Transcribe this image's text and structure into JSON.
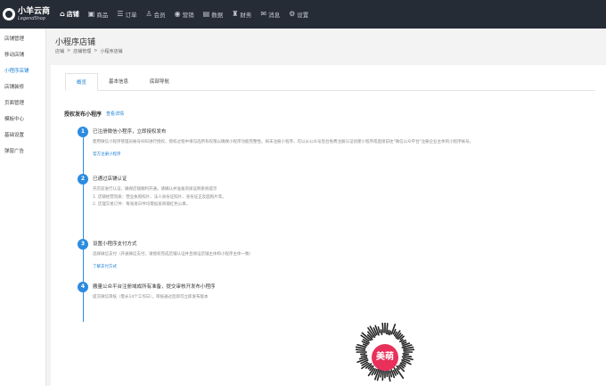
{
  "brand": {
    "name_cn": "小羊云商",
    "name_en": "LegendShop"
  },
  "nav": [
    {
      "label": "店铺",
      "icon": "home-icon",
      "glyph": "⌂",
      "active": true
    },
    {
      "label": "商品",
      "icon": "goods-icon",
      "glyph": "▣"
    },
    {
      "label": "订单",
      "icon": "order-icon",
      "glyph": "☰"
    },
    {
      "label": "会员",
      "icon": "member-icon",
      "glyph": "♙"
    },
    {
      "label": "营销",
      "icon": "marketing-icon",
      "glyph": "◉"
    },
    {
      "label": "数据",
      "icon": "data-icon",
      "glyph": "▤"
    },
    {
      "label": "财务",
      "icon": "finance-icon",
      "glyph": "♜"
    },
    {
      "label": "消息",
      "icon": "message-icon",
      "glyph": "✉"
    },
    {
      "label": "设置",
      "icon": "settings-icon",
      "glyph": "⚙"
    }
  ],
  "sidebar": {
    "items": [
      {
        "label": "店铺管理"
      },
      {
        "label": "移动店铺"
      },
      {
        "label": "小程序店铺",
        "active": true
      },
      {
        "label": "店铺装修"
      },
      {
        "label": "页面管理"
      },
      {
        "label": "模板中心"
      },
      {
        "label": "基础设置"
      },
      {
        "label": "弹窗广告"
      }
    ]
  },
  "page": {
    "title": "小程序店铺",
    "breadcrumb": [
      "店铺",
      ">",
      "店铺管理",
      ">",
      "小程序店铺"
    ]
  },
  "tabs": [
    {
      "label": "概览",
      "active": true
    },
    {
      "label": "基本信息"
    },
    {
      "label": "底部导航"
    }
  ],
  "section": {
    "title": "授权发布小程序",
    "link": "查看详情"
  },
  "steps": [
    {
      "num": "1",
      "title": "已注册微信小程序，立即授权发布",
      "desc": [
        "使用微信小程序管理员帐号扫码进行授权，授权过程中请勾选所有权限以确保小程序功能完整性。如未注册小程序，可以从公众号后台免费注册认证创建小程序或直接前往\"微信公众平台\"注册企业主体的小程序帐号。"
      ],
      "link": "官方注册小程序"
    },
    {
      "num": "2",
      "title": "已通过店铺认证",
      "desc": [
        "开店前进行认证，确保店铺顺利开通。请确认并准备资质证明系统提示",
        "1. 店铺经营资质：营业执照照片、法人身份证照片、身份证正反面照片等。",
        "2. 店理交易订件：每张发日件均需加盖商铺红色公章。"
      ],
      "link": ""
    },
    {
      "num": "3",
      "title": "设置小程序支付方式",
      "desc": [
        "选择微信支付（开通微信支付，请授权完成店铺认证并且保证店铺主体和小程序主体一致）"
      ],
      "link": "了解支付方式"
    },
    {
      "num": "4",
      "title": "搬量公众平台注册域成所有准备，提交审核开发布小程序",
      "desc": [
        "提交微信审核（需长14个工作日），审核通过后即可立即发布版本"
      ],
      "link": ""
    }
  ],
  "qr": {
    "badge": "美萌"
  },
  "colors": {
    "accent": "#2c8be0",
    "nav_bg": "#262c36",
    "badge": "#e8305a"
  }
}
